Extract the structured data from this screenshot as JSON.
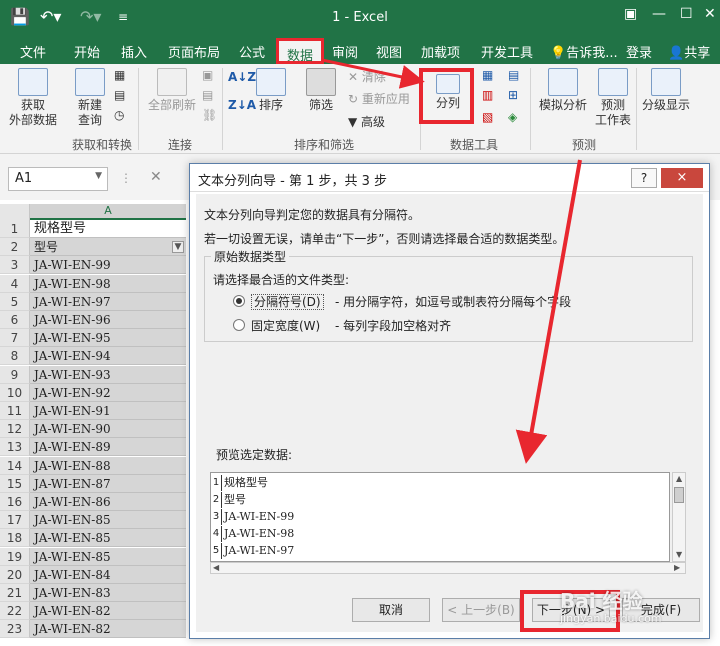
{
  "titlebar": {
    "save_icon": "save-icon",
    "undo_icon": "undo-icon",
    "redo_icon": "redo-icon",
    "customize_icon": "customize-qat-icon",
    "title": "1 - Excel"
  },
  "tabs": {
    "file": "文件",
    "home": "开始",
    "insert": "插入",
    "page_layout": "页面布局",
    "formulas": "公式",
    "data": "数据",
    "review": "审阅",
    "view": "视图",
    "addins": "加载项",
    "developer": "开发工具",
    "tellme": "告诉我...",
    "login": "登录",
    "share": "共享"
  },
  "ribbon": {
    "get_external": "获取\n外部数据",
    "new_query": "新建\n查询",
    "refresh_all": "全部刷新",
    "sort": "排序",
    "filter": "筛选",
    "clear": "清除",
    "reapply": "重新应用",
    "advanced": "高级",
    "text_to_columns": "分列",
    "what_if": "模拟分析",
    "forecast_sheet": "预测\n工作表",
    "outline": "分级显示",
    "group_get_transform": "获取和转换",
    "group_connections": "连接",
    "group_sort_filter": "排序和筛选",
    "group_data_tools": "数据工具",
    "group_forecast": "预测"
  },
  "formula_bar": {
    "name_box": "A1",
    "cancel_icon": "x-icon"
  },
  "sheet": {
    "column": "A",
    "rows": [
      {
        "n": "1",
        "v": "规格型号"
      },
      {
        "n": "2",
        "v": "型号"
      },
      {
        "n": "3",
        "v": "JA-WI-EN-99"
      },
      {
        "n": "4",
        "v": "JA-WI-EN-98"
      },
      {
        "n": "5",
        "v": "JA-WI-EN-97"
      },
      {
        "n": "6",
        "v": "JA-WI-EN-96"
      },
      {
        "n": "7",
        "v": "JA-WI-EN-95"
      },
      {
        "n": "8",
        "v": "JA-WI-EN-94"
      },
      {
        "n": "9",
        "v": "JA-WI-EN-93"
      },
      {
        "n": "10",
        "v": "JA-WI-EN-92"
      },
      {
        "n": "11",
        "v": "JA-WI-EN-91"
      },
      {
        "n": "12",
        "v": "JA-WI-EN-90"
      },
      {
        "n": "13",
        "v": "JA-WI-EN-89"
      },
      {
        "n": "14",
        "v": "JA-WI-EN-88"
      },
      {
        "n": "15",
        "v": "JA-WI-EN-87"
      },
      {
        "n": "16",
        "v": "JA-WI-EN-86"
      },
      {
        "n": "17",
        "v": "JA-WI-EN-85"
      },
      {
        "n": "18",
        "v": "JA-WI-EN-85"
      },
      {
        "n": "19",
        "v": "JA-WI-EN-85"
      },
      {
        "n": "20",
        "v": "JA-WI-EN-84"
      },
      {
        "n": "21",
        "v": "JA-WI-EN-83"
      },
      {
        "n": "22",
        "v": "JA-WI-EN-82"
      },
      {
        "n": "23",
        "v": "JA-WI-EN-82"
      }
    ]
  },
  "dialog": {
    "title": "文本分列向导 - 第 1 步，共 3 步",
    "help": "?",
    "close": "×",
    "line1": "文本分列向导判定您的数据具有分隔符。",
    "line2": "若一切设置无误，请单击“下一步”，否则请选择最合适的数据类型。",
    "group_legend": "原始数据类型",
    "choose_label": "请选择最合适的文件类型:",
    "opt_delimited": "分隔符号(D)",
    "opt_delimited_desc": "- 用分隔字符，如逗号或制表符分隔每个字段",
    "opt_fixed": "固定宽度(W)",
    "opt_fixed_desc": "- 每列字段加空格对齐",
    "preview_label": "预览选定数据:",
    "preview_rows": [
      {
        "n": "1",
        "v": "规格型号"
      },
      {
        "n": "2",
        "v": "型号"
      },
      {
        "n": "3",
        "v": "JA-WI-EN-99"
      },
      {
        "n": "4",
        "v": "JA-WI-EN-98"
      },
      {
        "n": "5",
        "v": "JA-WI-EN-97"
      }
    ],
    "btn_cancel": "取消",
    "btn_back": "< 上一步(B)",
    "btn_next": "下一步(N) >",
    "btn_finish": "完成(F)"
  },
  "watermark": {
    "main": "Bai 经验",
    "sub": "jingyan.baidu.com"
  },
  "colors": {
    "excel_green": "#217346",
    "highlight_red": "#e8272f"
  }
}
